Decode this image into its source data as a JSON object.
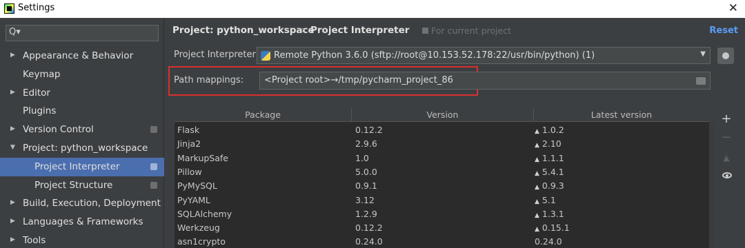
{
  "window": {
    "title": "Settings",
    "close_glyph": "✕"
  },
  "search": {
    "icon": "Q▾"
  },
  "sidebar": {
    "items": [
      {
        "label": "Appearance & Behavior",
        "expandable": true,
        "expanded": false
      },
      {
        "label": "Keymap",
        "expandable": false
      },
      {
        "label": "Editor",
        "expandable": true,
        "expanded": false
      },
      {
        "label": "Plugins",
        "expandable": false
      },
      {
        "label": "Version Control",
        "expandable": true,
        "expanded": false
      },
      {
        "label": "Project: python_workspace",
        "expandable": true,
        "expanded": true
      },
      {
        "label": "Project Interpreter",
        "child": true,
        "selected": true
      },
      {
        "label": "Project Structure",
        "child": true
      },
      {
        "label": "Build, Execution, Deployment",
        "expandable": true,
        "expanded": false
      },
      {
        "label": "Languages & Frameworks",
        "expandable": true,
        "expanded": false
      },
      {
        "label": "Tools",
        "expandable": true,
        "expanded": false
      }
    ]
  },
  "header": {
    "crumb_project": "Project: python_workspace",
    "crumb_sep": "›",
    "crumb_page": "Project Interpreter",
    "current_project": "For current project",
    "reset": "Reset"
  },
  "interpreter": {
    "label": "Project Interpreter:",
    "value": "Remote Python 3.6.0 (sftp://root@10.153.52.178:22/usr/bin/python) (1)"
  },
  "path_mappings": {
    "label": "Path mappings:",
    "value": "<Project root>→/tmp/pycharm_project_86"
  },
  "table": {
    "columns": [
      "Package",
      "Version",
      "Latest version"
    ],
    "rows": [
      {
        "package": "Flask",
        "version": "0.12.2",
        "latest": "1.0.2",
        "upgrade": true
      },
      {
        "package": "Jinja2",
        "version": "2.9.6",
        "latest": "2.10",
        "upgrade": true
      },
      {
        "package": "MarkupSafe",
        "version": "1.0",
        "latest": "1.1.1",
        "upgrade": true
      },
      {
        "package": "Pillow",
        "version": "5.0.0",
        "latest": "5.4.1",
        "upgrade": true
      },
      {
        "package": "PyMySQL",
        "version": "0.9.1",
        "latest": "0.9.3",
        "upgrade": true
      },
      {
        "package": "PyYAML",
        "version": "3.12",
        "latest": "5.1",
        "upgrade": true
      },
      {
        "package": "SQLAlchemy",
        "version": "1.2.9",
        "latest": "1.3.1",
        "upgrade": true
      },
      {
        "package": "Werkzeug",
        "version": "0.12.2",
        "latest": "0.15.1",
        "upgrade": true
      },
      {
        "package": "asn1crypto",
        "version": "0.24.0",
        "latest": "0.24.0",
        "upgrade": false
      }
    ]
  },
  "tools": {
    "add": "+",
    "remove": "−",
    "upgrade": "▲"
  },
  "colors": {
    "accent": "#589df6",
    "selection": "#4b6eaf",
    "highlight_border": "#d9302f"
  }
}
